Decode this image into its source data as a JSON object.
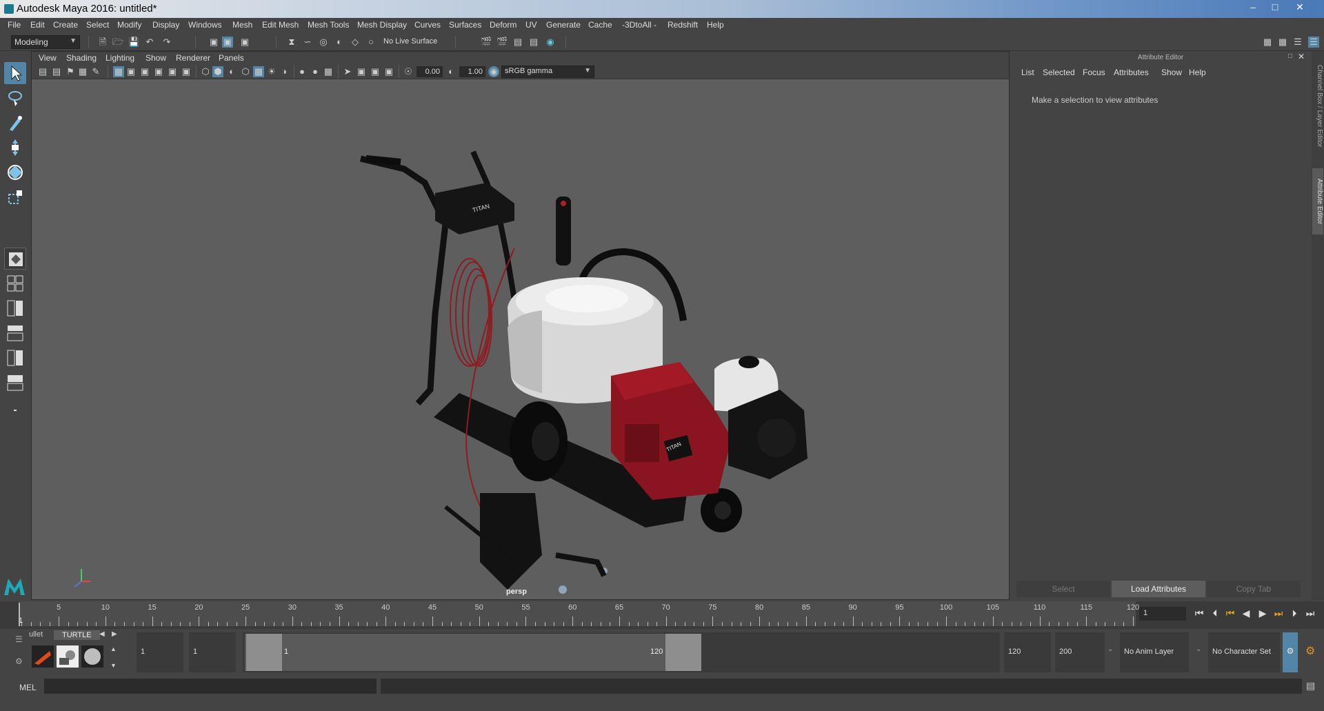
{
  "window": {
    "title": "Autodesk Maya 2016: untitled*",
    "controls": [
      "minimize-icon",
      "maximize-icon",
      "close-icon"
    ]
  },
  "menubar": {
    "items": [
      "File",
      "Edit",
      "Create",
      "Select",
      "Modify",
      "Display",
      "Windows",
      "Mesh",
      "Edit Mesh",
      "Mesh Tools",
      "Mesh Display",
      "Curves",
      "Surfaces",
      "Deform",
      "UV",
      "Generate",
      "Cache",
      "-3DtoAll -",
      "Redshift",
      "Help"
    ]
  },
  "statusline": {
    "mode": "Modeling",
    "live_surface": "No Live Surface"
  },
  "viewport": {
    "menus": [
      "View",
      "Shading",
      "Lighting",
      "Show",
      "Renderer",
      "Panels"
    ],
    "exposure": "0.00",
    "gamma": "1.00",
    "colorspace": "sRGB gamma",
    "camera_label": "persp"
  },
  "attribute_editor": {
    "title": "Attribute Editor",
    "menus": [
      "List",
      "Selected",
      "Focus",
      "Attributes",
      "Show",
      "Help"
    ],
    "message": "Make a selection to view attributes",
    "buttons": {
      "select": "Select",
      "load": "Load Attributes",
      "copy_tab": "Copy Tab"
    },
    "side_tabs": [
      "Channel Box / Layer Editor",
      "Attribute Editor"
    ]
  },
  "timeslider": {
    "ticks": [
      1,
      5,
      10,
      15,
      20,
      25,
      30,
      35,
      40,
      45,
      50,
      55,
      60,
      65,
      70,
      75,
      80,
      85,
      90,
      95,
      100,
      105,
      110,
      115,
      120
    ],
    "current_frame": "1",
    "current_frame_marker": "1"
  },
  "range": {
    "shelf_tabs": [
      "ullet",
      "TURTLE"
    ],
    "start_frame": "1",
    "playback_start": "1",
    "range_start_label": "1",
    "range_end_label": "120",
    "playback_end": "120",
    "end_frame": "200",
    "anim_layer": "No Anim Layer",
    "character_set": "No Character Set"
  },
  "commandline": {
    "label": "MEL"
  },
  "colors": {
    "accent": "#5285a6",
    "background": "#444444",
    "viewport_bg": "#5e5e5e",
    "machine_red": "#8a1420"
  }
}
